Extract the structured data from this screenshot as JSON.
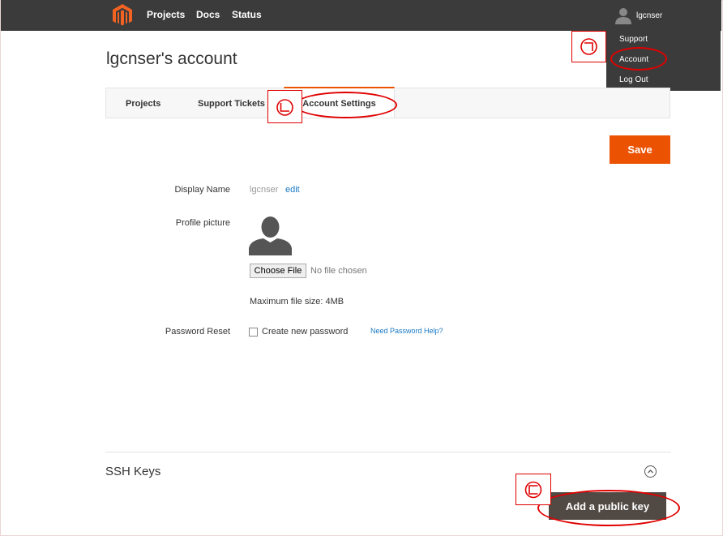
{
  "topbar": {
    "nav": [
      "Projects",
      "Docs",
      "Status"
    ],
    "username": "lgcnser"
  },
  "dropdown": {
    "items": [
      "Support",
      "Account",
      "Log Out"
    ]
  },
  "page": {
    "title": "lgcnser's account"
  },
  "tabs": [
    "Projects",
    "Support Tickets",
    "Account Settings"
  ],
  "actions": {
    "save_label": "Save",
    "add_key_label": "Add a public key"
  },
  "form": {
    "display_name_label": "Display Name",
    "display_name_value": "lgcnser",
    "edit_label": "edit",
    "profile_picture_label": "Profile picture",
    "choose_file_label": "Choose File",
    "no_file_text": "No file chosen",
    "max_size_text": "Maximum file size: 4MB",
    "password_reset_label": "Password Reset",
    "create_password_label": "Create new password",
    "password_help_link": "Need Password Help?"
  },
  "ssh": {
    "title": "SSH Keys"
  },
  "annotations": [
    "ㄱ",
    "ㄴ",
    "ㄷ"
  ],
  "colors": {
    "topbar": "#3c3b3b",
    "accent": "#eb5202",
    "link": "#1979c3",
    "annotation": "#e00000",
    "secondary_button": "#514943"
  },
  "icons": [
    "magento-logo-icon",
    "user-avatar-icon",
    "profile-placeholder-icon",
    "chevron-up-icon"
  ]
}
